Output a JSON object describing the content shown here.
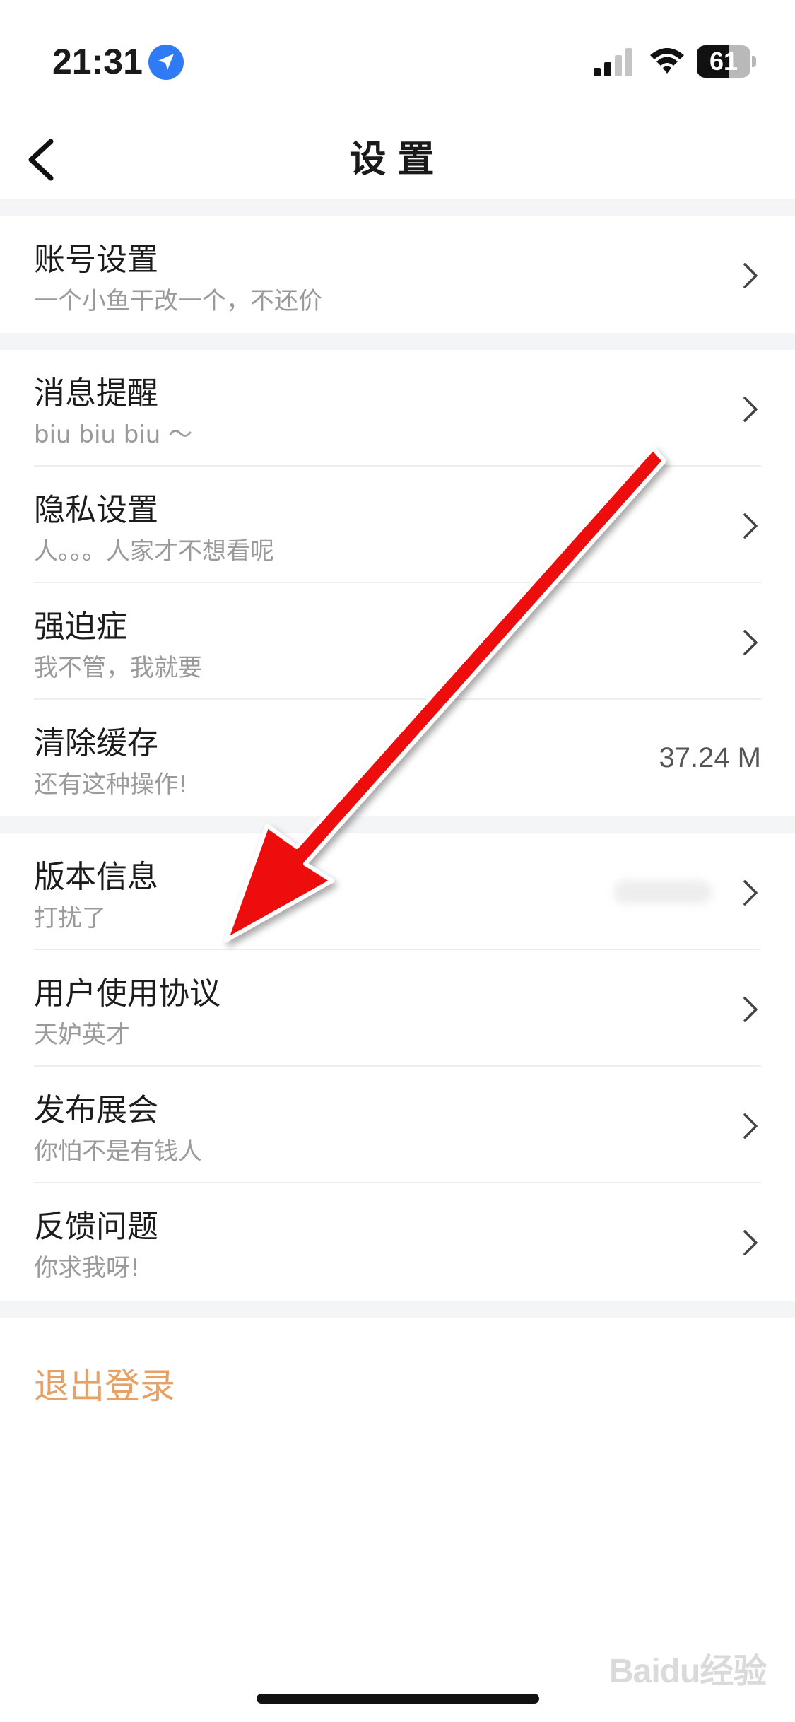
{
  "status_bar": {
    "time": "21:31",
    "battery": "61",
    "battery_level": 0.61,
    "icons": [
      "location-arrow-icon",
      "cellular-signal-icon",
      "wifi-icon",
      "battery-icon"
    ]
  },
  "nav": {
    "title": "设置",
    "back_icon": "chevron-left-icon"
  },
  "sections": [
    {
      "rows": [
        {
          "title": "账号设置",
          "subtitle": "一个小鱼干改一个，不还价"
        }
      ]
    },
    {
      "rows": [
        {
          "title": "消息提醒",
          "subtitle": "biu biu biu ～"
        },
        {
          "title": "隐私设置",
          "subtitle": "人。。。人家才不想看呢"
        },
        {
          "title": "强迫症",
          "subtitle": "我不管，我就要"
        },
        {
          "title": "清除缓存",
          "subtitle": "还有这种操作!",
          "value": "37.24 M"
        }
      ]
    },
    {
      "rows": [
        {
          "title": "版本信息",
          "subtitle": "打扰了"
        },
        {
          "title": "用户使用协议",
          "subtitle": "天妒英才"
        },
        {
          "title": "发布展会",
          "subtitle": "你怕不是有钱人"
        },
        {
          "title": "反馈问题",
          "subtitle": "你求我呀!"
        }
      ]
    }
  ],
  "logout": "退出登录",
  "watermark": "Baidu经验",
  "colors": {
    "logout": "#e8a164",
    "annotation_arrow": "#ee1111",
    "separator": "#f4f5f7"
  }
}
